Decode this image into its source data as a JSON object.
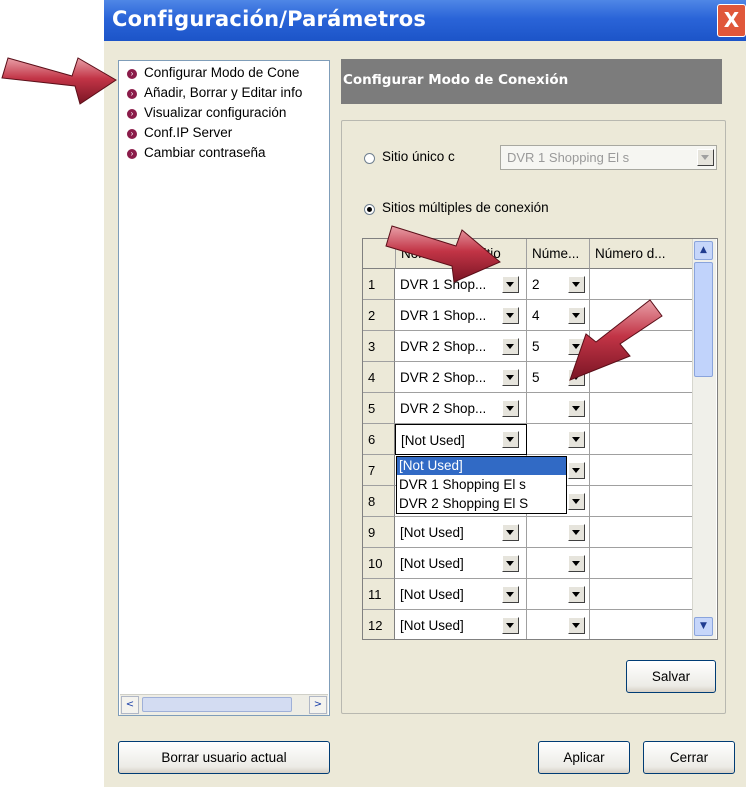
{
  "window": {
    "title": "Configuración/Parámetros",
    "close_glyph": "X"
  },
  "tree": {
    "items": [
      {
        "label": "Configurar Modo de Cone",
        "icon": "bullet-arrow-icon"
      },
      {
        "label": "Añadir, Borrar y Editar info",
        "icon": "bullet-arrow-icon"
      },
      {
        "label": "Visualizar configuración",
        "icon": "bullet-arrow-icon"
      },
      {
        "label": "Conf.IP Server",
        "icon": "bullet-arrow-icon"
      },
      {
        "label": "Cambiar contraseña",
        "icon": "bullet-arrow-icon"
      }
    ],
    "scroll_left": "<",
    "scroll_right": ">"
  },
  "panel": {
    "header": "Configurar Modo de Conexión",
    "single_site": {
      "label": "Sitio único c",
      "selected": false,
      "combo_value": "DVR 1 Shopping El s"
    },
    "multi_site": {
      "label": "Sitios múltiples de conexión",
      "selected": true
    }
  },
  "grid": {
    "columns": [
      "Nombre del Sitio",
      "Núme...",
      "Número d..."
    ],
    "rows": [
      {
        "num": "1",
        "site": "DVR 1 Shop...",
        "n": "2",
        "d": ""
      },
      {
        "num": "2",
        "site": "DVR 1 Shop...",
        "n": "4",
        "d": ""
      },
      {
        "num": "3",
        "site": "DVR 2 Shop...",
        "n": "5",
        "d": ""
      },
      {
        "num": "4",
        "site": "DVR 2 Shop...",
        "n": "5",
        "d": ""
      },
      {
        "num": "5",
        "site": "DVR 2 Shop...",
        "n": "",
        "d": ""
      },
      {
        "num": "6",
        "site": "[Not Used]",
        "n": "",
        "d": ""
      },
      {
        "num": "7",
        "site": "",
        "n": "",
        "d": ""
      },
      {
        "num": "8",
        "site": "",
        "n": "",
        "d": ""
      },
      {
        "num": "9",
        "site": "[Not Used]",
        "n": "",
        "d": ""
      },
      {
        "num": "10",
        "site": "[Not Used]",
        "n": "",
        "d": ""
      },
      {
        "num": "11",
        "site": "[Not Used]",
        "n": "",
        "d": ""
      },
      {
        "num": "12",
        "site": "[Not Used]",
        "n": "",
        "d": ""
      }
    ],
    "dropdown_options": [
      "[Not Used]",
      "DVR 1 Shopping El s",
      "DVR 2 Shopping El S"
    ],
    "dropdown_selected": 0
  },
  "buttons": {
    "save": "Salvar",
    "delete_user": "Borrar usuario actual",
    "apply": "Aplicar",
    "close": "Cerrar"
  },
  "colors": {
    "title_bar": "#2a64d8",
    "panel_header": "#7c7c7c",
    "annotation_arrow": "#b8283a",
    "selection": "#316ac5"
  }
}
